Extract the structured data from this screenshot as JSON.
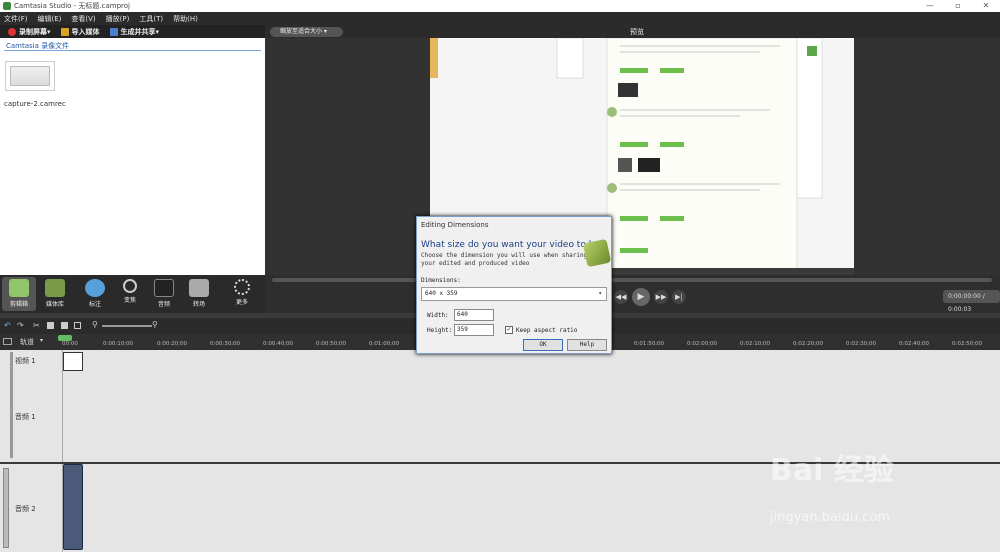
{
  "titlebar": {
    "title": "Camtasia Studio - 无标题.camproj",
    "min": "—",
    "max": "▫",
    "close": "✕"
  },
  "menu": [
    "文件(F)",
    "编辑(E)",
    "查看(V)",
    "播放(P)",
    "工具(T)",
    "帮助(H)"
  ],
  "toolbar": {
    "record": "录制屏幕",
    "import": "导入媒体",
    "produce": "生成并共享"
  },
  "clipbin": {
    "header": "Camtasia 录像文件",
    "clip_name": "capture-2.camrec"
  },
  "preview": {
    "zoom": "缩放至适合大小",
    "label": "预览",
    "timecode": "0:00:00:00 / 0:00:03"
  },
  "tasks": [
    "剪辑箱",
    "媒体库",
    "标注",
    "变焦",
    "音频",
    "转场",
    "更多"
  ],
  "timeline": {
    "tracks_label": "轨道",
    "ruler": [
      "00:00",
      "0:00:10;00",
      "0:00:20;00",
      "0:00:30;00",
      "0:00:40;00",
      "0:00:50;00",
      "0:01:00;00",
      "0:01:50;00",
      "0:02:00;00",
      "0:02:10;00",
      "0:02:20;00",
      "0:02:30;00",
      "0:02:40;00",
      "0:02:50;00"
    ],
    "track_video": "视频 1",
    "track_audio1": "音频 1",
    "track_audio2": "音频 2"
  },
  "dialog": {
    "title": "Editing Dimensions",
    "question": "What size do you want your video to be?",
    "description": "Choose the dimension you will use when sharing your edited and produced video",
    "dimensions_label": "Dimensions:",
    "dimension_value": "640 x 359",
    "width_label": "Width:",
    "width_value": "640",
    "height_label": "Height:",
    "height_value": "359",
    "keep_aspect": "Keep aspect ratio",
    "ok": "OK",
    "help": "Help"
  },
  "watermark": {
    "brand": "Bai 经验",
    "url": "jingyan.baidu.com"
  }
}
